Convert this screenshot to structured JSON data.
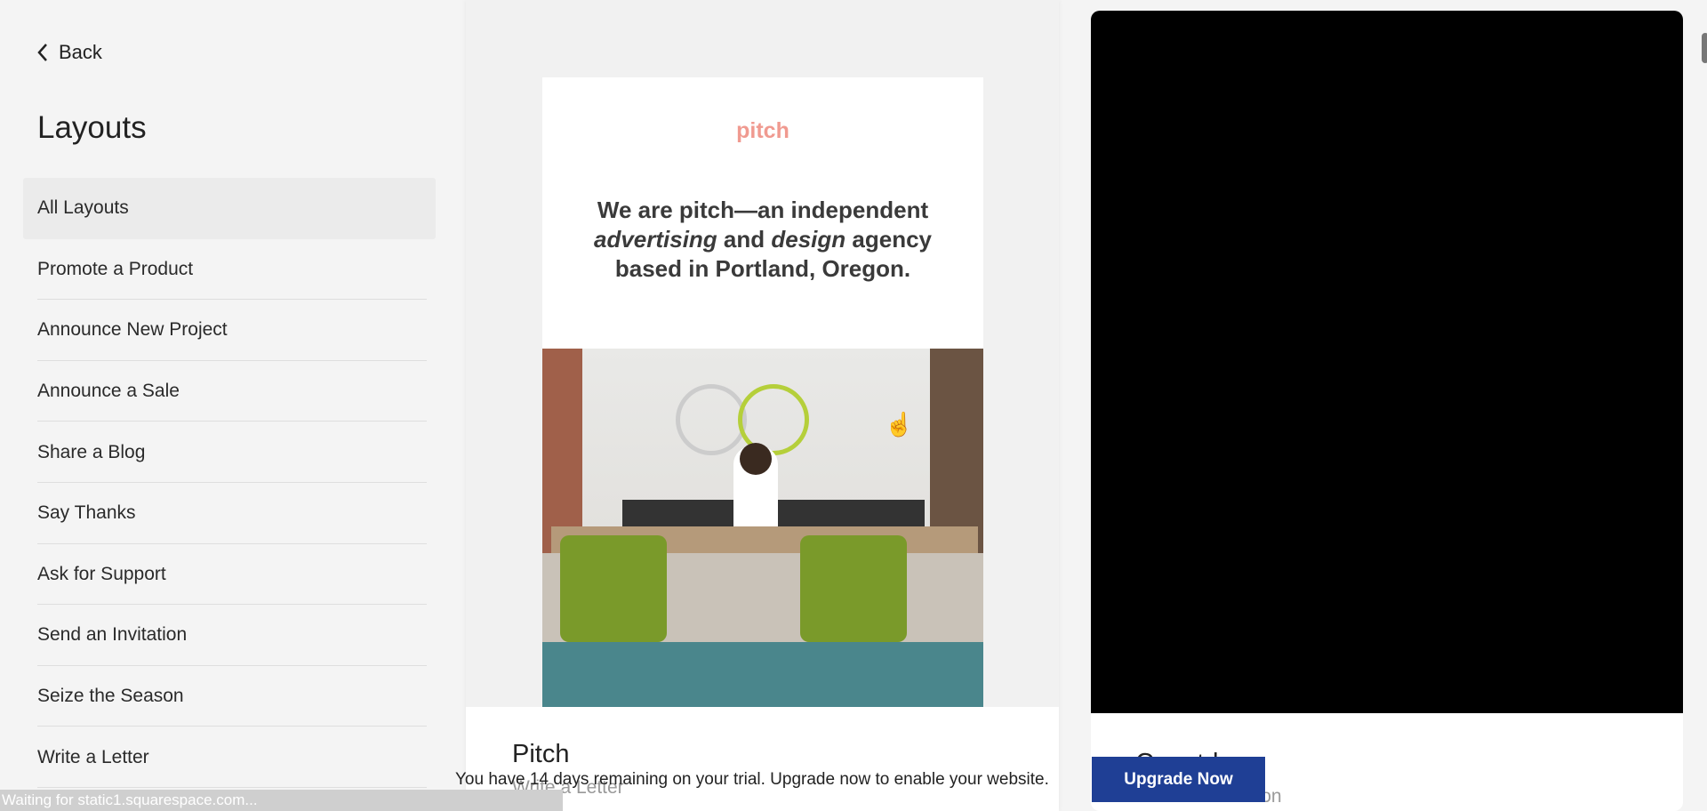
{
  "sidebar": {
    "back_label": "Back",
    "title": "Layouts",
    "items": [
      {
        "label": "All Layouts",
        "active": true
      },
      {
        "label": "Promote a Product"
      },
      {
        "label": "Announce New Project"
      },
      {
        "label": "Announce a Sale"
      },
      {
        "label": "Share a Blog"
      },
      {
        "label": "Say Thanks"
      },
      {
        "label": "Ask for Support"
      },
      {
        "label": "Send an Invitation"
      },
      {
        "label": "Seize the Season"
      },
      {
        "label": "Write a Letter"
      }
    ]
  },
  "cards": [
    {
      "preview": {
        "logo": "pitch",
        "headline_1": "We are pitch—an independent",
        "headline_2a": "advertising",
        "headline_2b": " and ",
        "headline_2c": "design",
        "headline_2d": " agency",
        "headline_3": "based in Portland, Oregon."
      },
      "title": "Pitch",
      "subtitle": "Write a Letter"
    },
    {
      "title": "Countdown",
      "subtitle": "Seize the Season"
    }
  ],
  "banner": {
    "text": "You have 14 days remaining on your trial. Upgrade now to enable your website.",
    "button": "Upgrade Now",
    "button_color": "#1f3f95"
  },
  "status_bar": "Waiting for static1.squarespace.com..."
}
